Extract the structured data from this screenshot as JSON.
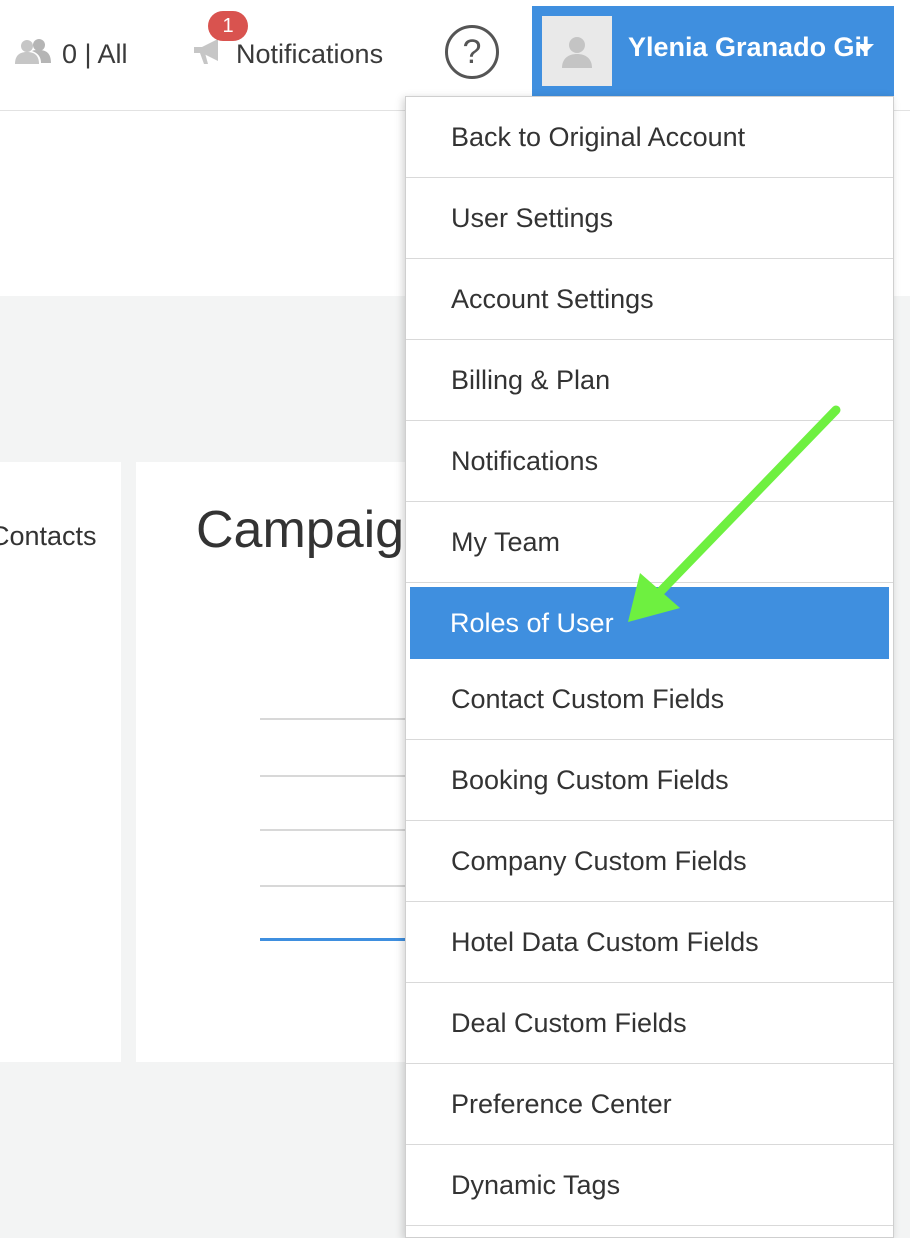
{
  "header": {
    "users_count": "0 | All",
    "notifications_label": "Notifications",
    "notifications_badge": "1",
    "help_icon": "?",
    "user_name": "Ylenia Granado Gil"
  },
  "background": {
    "contacts_label": "Contacts",
    "campaign_label": "Campaign"
  },
  "dropdown": {
    "items": [
      "Back to Original Account",
      "User Settings",
      "Account Settings",
      "Billing & Plan",
      "Notifications",
      "My Team",
      "Roles of User",
      "Contact Custom Fields",
      "Booking Custom Fields",
      "Company Custom Fields",
      "Hotel Data Custom Fields",
      "Deal Custom Fields",
      "Preference Center",
      "Dynamic Tags"
    ],
    "active_item": "Roles of User"
  },
  "colors": {
    "accent": "#3f8fdf",
    "badge": "#d9534f",
    "annotation_arrow": "#6ef040"
  },
  "icons": [
    "users-icon",
    "megaphone-icon",
    "help-icon",
    "avatar-icon",
    "chevron-down-icon"
  ]
}
